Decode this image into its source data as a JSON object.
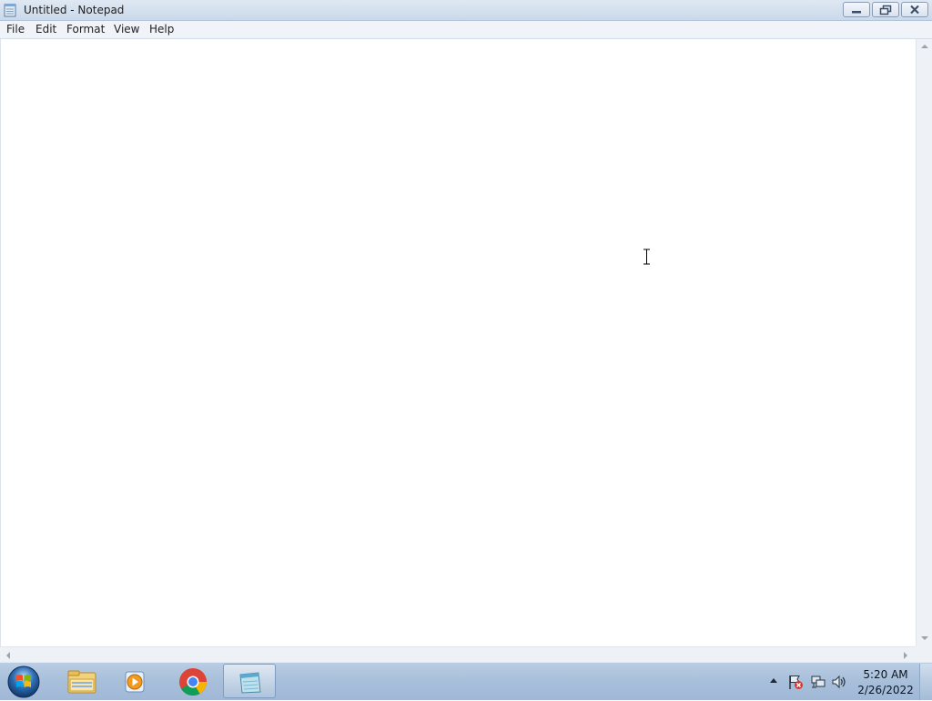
{
  "window": {
    "title": "Untitled - Notepad",
    "icon": "notepad-icon"
  },
  "menu": {
    "items": [
      {
        "label": "File"
      },
      {
        "label": "Edit"
      },
      {
        "label": "Format"
      },
      {
        "label": "View"
      },
      {
        "label": "Help"
      }
    ]
  },
  "editor": {
    "content": ""
  },
  "taskbar": {
    "start": "start-orb-icon",
    "pinned": [
      {
        "name": "windows-explorer",
        "icon": "folder-icon"
      },
      {
        "name": "windows-media-player",
        "icon": "media-player-icon"
      },
      {
        "name": "google-chrome",
        "icon": "chrome-icon"
      },
      {
        "name": "notepad",
        "icon": "notepad-icon",
        "active": true
      }
    ],
    "tray": {
      "icons": [
        "show-hidden-icons-arrow",
        "action-center-flag-icon",
        "network-icon",
        "volume-icon"
      ]
    },
    "clock": {
      "time": "5:20 AM",
      "date": "2/26/2022"
    }
  },
  "colors": {
    "titlebar": "#cad9ea",
    "menubar": "#f0f4f9",
    "taskbar": "#a9c0db",
    "close_button": "#c9463d"
  }
}
